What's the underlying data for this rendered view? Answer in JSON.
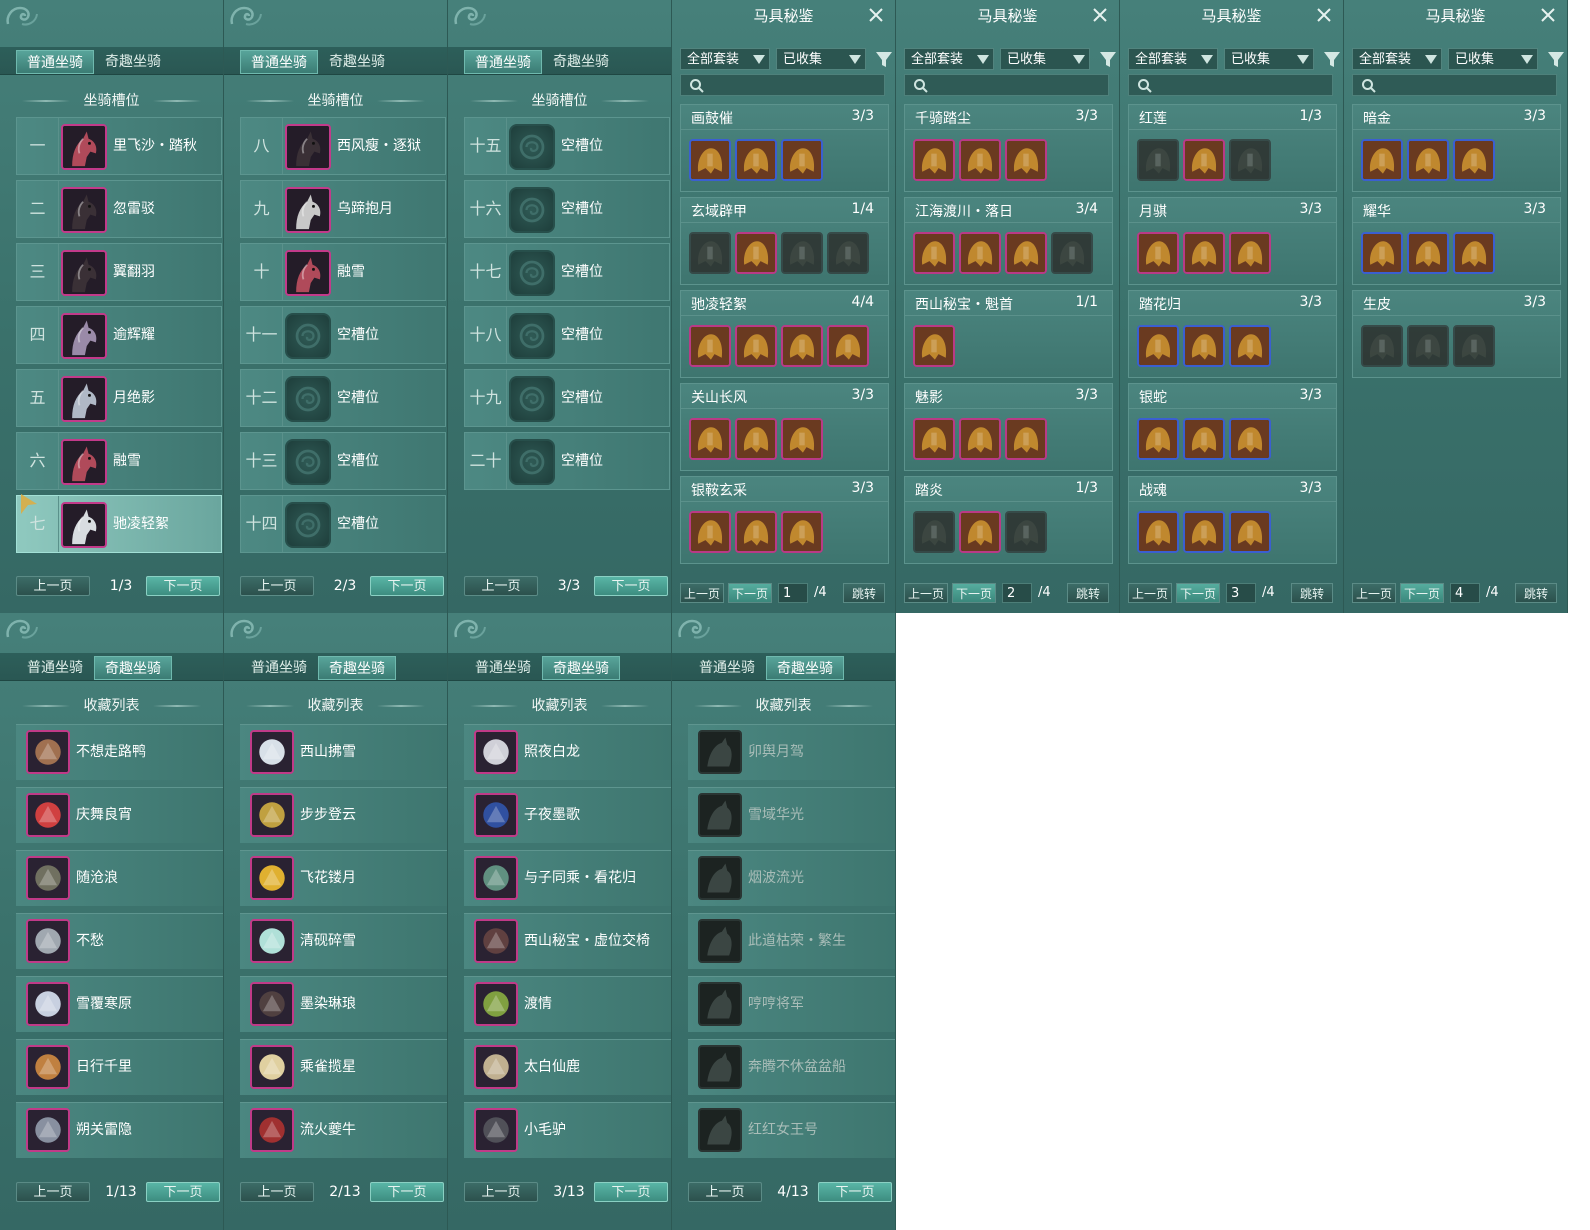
{
  "tabs": {
    "normal": "普通坐骑",
    "special": "奇趣坐骑"
  },
  "section": {
    "mount_slots": "坐骑槽位",
    "collection": "收藏列表"
  },
  "pager": {
    "prev": "上一页",
    "next": "下一页"
  },
  "mount_pages": [
    {
      "page": "1/3",
      "rows": [
        {
          "num": "一",
          "name": "里飞沙・踏秋",
          "color": "#b04a5a"
        },
        {
          "num": "二",
          "name": "忽雷驳",
          "color": "#3a3036"
        },
        {
          "num": "三",
          "name": "翼翻羽",
          "color": "#3a3036"
        },
        {
          "num": "四",
          "name": "逾辉耀",
          "color": "#9a8aa8"
        },
        {
          "num": "五",
          "name": "月绝影",
          "color": "#b0b8c6"
        },
        {
          "num": "六",
          "name": "融雪",
          "color": "#b04a5a"
        },
        {
          "num": "七",
          "name": "驰凌轻絮",
          "color": "#d8dce0",
          "selected": true
        }
      ]
    },
    {
      "page": "2/3",
      "rows": [
        {
          "num": "八",
          "name": "西风瘦・逐狱",
          "color": "#3a3036"
        },
        {
          "num": "九",
          "name": "乌蹄抱月",
          "color": "#c8c8c8"
        },
        {
          "num": "十",
          "name": "融雪",
          "color": "#b04a5a"
        },
        {
          "num": "十一",
          "name": "空槽位",
          "empty": true
        },
        {
          "num": "十二",
          "name": "空槽位",
          "empty": true
        },
        {
          "num": "十三",
          "name": "空槽位",
          "empty": true
        },
        {
          "num": "十四",
          "name": "空槽位",
          "empty": true
        }
      ]
    },
    {
      "page": "3/3",
      "rows": [
        {
          "num": "十五",
          "name": "空槽位",
          "empty": true
        },
        {
          "num": "十六",
          "name": "空槽位",
          "empty": true
        },
        {
          "num": "十七",
          "name": "空槽位",
          "empty": true
        },
        {
          "num": "十八",
          "name": "空槽位",
          "empty": true
        },
        {
          "num": "十九",
          "name": "空槽位",
          "empty": true
        },
        {
          "num": "二十",
          "name": "空槽位",
          "empty": true
        }
      ]
    }
  ],
  "saddle": {
    "title": "马具秘鉴",
    "filter_all": "全部套装",
    "filter_collected": "已收集",
    "jump": "跳转",
    "total": "/4",
    "pages": [
      {
        "page": "1",
        "sets": [
          {
            "name": "画鼓催",
            "count": "3/3",
            "items": [
              "blue",
              "blue",
              "blue"
            ]
          },
          {
            "name": "玄域辟甲",
            "count": "1/4",
            "items": [
              "gray",
              "pink",
              "gray",
              "gray"
            ]
          },
          {
            "name": "驰凌轻絮",
            "count": "4/4",
            "items": [
              "pink",
              "pink",
              "pink",
              "pink"
            ]
          },
          {
            "name": "关山长风",
            "count": "3/3",
            "items": [
              "pink",
              "pink",
              "pink"
            ]
          },
          {
            "name": "银鞍玄采",
            "count": "3/3",
            "items": [
              "pink",
              "pink",
              "pink"
            ]
          }
        ]
      },
      {
        "page": "2",
        "sets": [
          {
            "name": "千骑踏尘",
            "count": "3/3",
            "items": [
              "pink",
              "pink",
              "pink"
            ]
          },
          {
            "name": "江海渡川・落日",
            "count": "3/4",
            "items": [
              "pink",
              "pink",
              "pink",
              "gray"
            ]
          },
          {
            "name": "西山秘宝・魁首",
            "count": "1/1",
            "items": [
              "pink"
            ]
          },
          {
            "name": "魅影",
            "count": "3/3",
            "items": [
              "pink",
              "pink",
              "pink"
            ]
          },
          {
            "name": "踏炎",
            "count": "1/3",
            "items": [
              "gray",
              "pink",
              "gray"
            ]
          }
        ]
      },
      {
        "page": "3",
        "sets": [
          {
            "name": "红莲",
            "count": "1/3",
            "items": [
              "gray",
              "pink",
              "gray"
            ]
          },
          {
            "name": "月骐",
            "count": "3/3",
            "items": [
              "pink",
              "pink",
              "pink"
            ]
          },
          {
            "name": "踏花归",
            "count": "3/3",
            "items": [
              "blue",
              "blue",
              "blue"
            ]
          },
          {
            "name": "银蛇",
            "count": "3/3",
            "items": [
              "blue",
              "blue",
              "blue"
            ]
          },
          {
            "name": "战魂",
            "count": "3/3",
            "items": [
              "blue",
              "blue",
              "blue"
            ]
          }
        ]
      },
      {
        "page": "4",
        "sets": [
          {
            "name": "暗金",
            "count": "3/3",
            "items": [
              "blue",
              "blue",
              "blue"
            ]
          },
          {
            "name": "耀华",
            "count": "3/3",
            "items": [
              "blue",
              "blue",
              "blue"
            ]
          },
          {
            "name": "生皮",
            "count": "3/3",
            "items": [
              "gray",
              "gray",
              "gray"
            ]
          }
        ]
      }
    ]
  },
  "collection_pages": [
    {
      "page": "1/13",
      "rows": [
        {
          "name": "不想走路鸭",
          "color": "#a07050"
        },
        {
          "name": "庆舞良宵",
          "color": "#d04040"
        },
        {
          "name": "随沧浪",
          "color": "#707060"
        },
        {
          "name": "不愁",
          "color": "#a0a8b0"
        },
        {
          "name": "雪覆寒原",
          "color": "#c8d0e0"
        },
        {
          "name": "日行千里",
          "color": "#c08040"
        },
        {
          "name": "朔关雷隐",
          "color": "#8890a0"
        }
      ]
    },
    {
      "page": "2/13",
      "rows": [
        {
          "name": "西山拂雪",
          "color": "#d8e0e8"
        },
        {
          "name": "步步登云",
          "color": "#c0a040"
        },
        {
          "name": "飞花镂月",
          "color": "#e0b030"
        },
        {
          "name": "清砚碎雪",
          "color": "#b0e0d8"
        },
        {
          "name": "墨染琳琅",
          "color": "#504040"
        },
        {
          "name": "乘雀揽星",
          "color": "#e0d0a0"
        },
        {
          "name": "流火夔牛",
          "color": "#a03030"
        }
      ]
    },
    {
      "page": "3/13",
      "rows": [
        {
          "name": "照夜白龙",
          "color": "#d0d0d8"
        },
        {
          "name": "子夜墨歌",
          "color": "#3050a0"
        },
        {
          "name": "与子同乘・看花归",
          "color": "#609080"
        },
        {
          "name": "西山秘宝・虚位交椅",
          "color": "#604040"
        },
        {
          "name": "渡情",
          "color": "#80a040"
        },
        {
          "name": "太白仙鹿",
          "color": "#c0b090"
        },
        {
          "name": "小毛驴",
          "color": "#505058"
        }
      ]
    },
    {
      "page": "4/13",
      "rows": [
        {
          "name": "卯舆月驾",
          "dim": true
        },
        {
          "name": "雪域华光",
          "dim": true
        },
        {
          "name": "烟波流光",
          "dim": true
        },
        {
          "name": "此道枯荣・繁生",
          "dim": true
        },
        {
          "name": "哼哼将军",
          "dim": true
        },
        {
          "name": "奔腾不休盆盆船",
          "dim": true
        },
        {
          "name": "红红女王号",
          "dim": true
        }
      ]
    }
  ]
}
